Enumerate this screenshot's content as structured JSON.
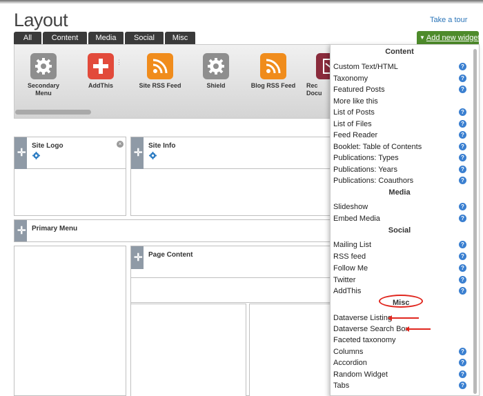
{
  "header": {
    "title": "Layout",
    "tour_link": "Take a tour"
  },
  "tabs": [
    {
      "label": "All"
    },
    {
      "label": "Content"
    },
    {
      "label": "Media"
    },
    {
      "label": "Social"
    },
    {
      "label": "Misc"
    }
  ],
  "add_widget": {
    "label": "Add new widget",
    "caret": "▼"
  },
  "tray": {
    "widgets": [
      {
        "name": "Secondary Menu",
        "icon": "gear-icon"
      },
      {
        "name": "AddThis",
        "icon": "plus-icon"
      },
      {
        "name": "Site RSS Feed",
        "icon": "rss-icon"
      },
      {
        "name": "Shield",
        "icon": "gear-icon"
      },
      {
        "name": "Blog RSS Feed",
        "icon": "rss-icon"
      },
      {
        "name": "Rec Docu",
        "icon": "document-icon"
      }
    ]
  },
  "regions": {
    "site_logo": {
      "title": "Site Logo"
    },
    "site_info": {
      "title": "Site Info"
    },
    "primary_menu": {
      "title": "Primary Menu"
    },
    "page_content": {
      "title": "Page Content"
    }
  },
  "menu": {
    "sections": {
      "content": "Content",
      "media": "Media",
      "social": "Social",
      "misc": "Misc"
    },
    "items": {
      "custom_text_html": "Custom Text/HTML",
      "taxonomy": "Taxonomy",
      "featured_posts": "Featured Posts",
      "more_like_this": "More like this",
      "list_of_posts": "List of Posts",
      "list_of_files": "List of Files",
      "feed_reader": "Feed Reader",
      "booklet_toc": "Booklet: Table of Contents",
      "publications_types": "Publications: Types",
      "publications_years": "Publications: Years",
      "publications_coauthors": "Publications: Coauthors",
      "slideshow": "Slideshow",
      "embed_media": "Embed Media",
      "mailing_list": "Mailing List",
      "rss_feed": "RSS feed",
      "follow_me": "Follow Me",
      "twitter": "Twitter",
      "addthis": "AddThis",
      "dataverse_listing": "Dataverse Listing",
      "dataverse_search_box": "Dataverse Search Box",
      "faceted_taxonomy": "Faceted taxonomy",
      "columns": "Columns",
      "accordion": "Accordion",
      "random_widget": "Random Widget",
      "tabs": "Tabs"
    },
    "help_glyph": "?"
  },
  "colors": {
    "tab_bg": "#3a3a3a",
    "add_widget_bg": "#4e8b2b",
    "link": "#2a74b8",
    "help_badge": "#3a7fd0",
    "annotation": "#e0261e"
  }
}
